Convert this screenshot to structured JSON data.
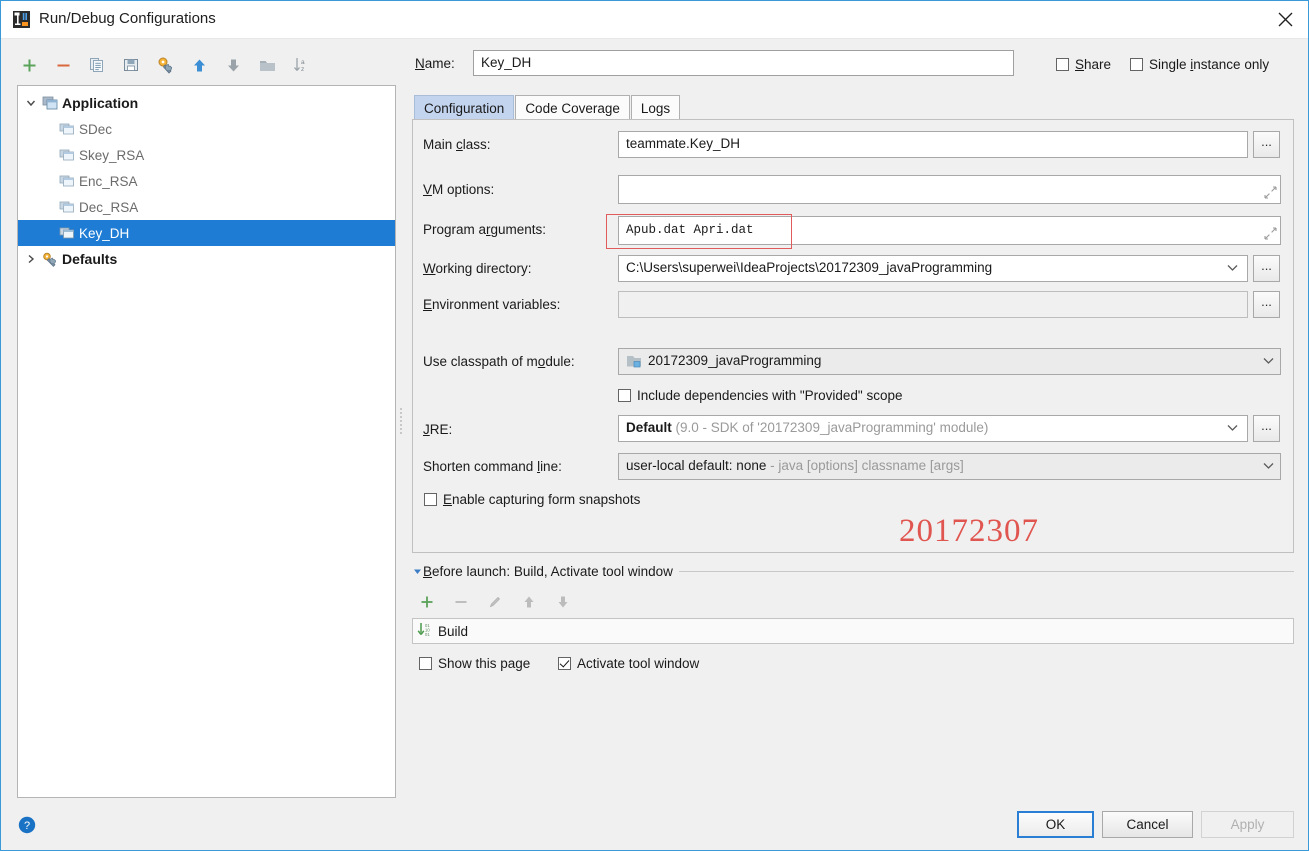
{
  "window": {
    "title": "Run/Debug Configurations",
    "app_icon": "intellij-idea-icon",
    "close_icon": "close-icon"
  },
  "toolbar": {
    "buttons": [
      {
        "name": "add-configuration-button",
        "icon": "plus-icon"
      },
      {
        "name": "remove-configuration-button",
        "icon": "minus-icon"
      },
      {
        "name": "copy-configuration-button",
        "icon": "copy-icon"
      },
      {
        "name": "save-configuration-button",
        "icon": "save-icon"
      },
      {
        "name": "edit-templates-button",
        "icon": "wrench-icon"
      },
      {
        "name": "move-up-button",
        "icon": "arrow-up-icon"
      },
      {
        "name": "move-down-button",
        "icon": "arrow-down-icon"
      },
      {
        "name": "move-into-folder-button",
        "icon": "folder-icon"
      },
      {
        "name": "sort-alphabetically-button",
        "icon": "sort-az-icon"
      }
    ]
  },
  "tree": {
    "items": [
      {
        "label": "Application",
        "icon": "application-icon",
        "bold": true,
        "twisty": "expanded",
        "indent": 0,
        "selected": false
      },
      {
        "label": "SDec",
        "icon": "run-config-icon",
        "bold": false,
        "twisty": "none",
        "indent": 1,
        "selected": false
      },
      {
        "label": "Skey_RSA",
        "icon": "run-config-icon",
        "bold": false,
        "twisty": "none",
        "indent": 1,
        "selected": false
      },
      {
        "label": "Enc_RSA",
        "icon": "run-config-icon",
        "bold": false,
        "twisty": "none",
        "indent": 1,
        "selected": false
      },
      {
        "label": "Dec_RSA",
        "icon": "run-config-icon",
        "bold": false,
        "twisty": "none",
        "indent": 1,
        "selected": false
      },
      {
        "label": "Key_DH",
        "icon": "run-config-icon",
        "bold": false,
        "twisty": "none",
        "indent": 1,
        "selected": true
      },
      {
        "label": "Defaults",
        "icon": "defaults-icon",
        "bold": true,
        "twisty": "collapsed",
        "indent": 0,
        "selected": false
      }
    ]
  },
  "name_row": {
    "label": "Name:",
    "value": "Key_DH",
    "share": {
      "label": "Share",
      "checked": false
    },
    "single_instance": {
      "label": "Single instance only",
      "checked": false
    }
  },
  "tabs": [
    {
      "label": "Configuration",
      "active": true
    },
    {
      "label": "Code Coverage",
      "active": false
    },
    {
      "label": "Logs",
      "active": false
    }
  ],
  "configuration": {
    "main_class": {
      "label": "Main class:",
      "value": "teammate.Key_DH",
      "browse": "..."
    },
    "vm_options": {
      "label": "VM options:",
      "value": "",
      "expand_icon": "expand-icon"
    },
    "program_arguments": {
      "label": "Program arguments:",
      "value": "Apub.dat Apri.dat",
      "expand_icon": "expand-icon",
      "highlight_color": "#e05b5b"
    },
    "working_directory": {
      "label": "Working directory:",
      "value": "C:\\Users\\superwei\\IdeaProjects\\20172309_javaProgramming",
      "browse": "..."
    },
    "environment_variables": {
      "label": "Environment variables:",
      "value": "",
      "browse": "..."
    },
    "use_classpath_of_module": {
      "label": "Use classpath of module:",
      "value": "20172309_javaProgramming",
      "icon": "module-icon"
    },
    "include_provided": {
      "label": "Include dependencies with \"Provided\" scope",
      "checked": false
    },
    "jre": {
      "label": "JRE:",
      "value": "Default",
      "hint": "(9.0 - SDK of '20172309_javaProgramming' module)",
      "browse": "..."
    },
    "shorten_command_line": {
      "label": "Shorten command line:",
      "value": "user-local default: none",
      "hint": "- java [options] classname [args]"
    },
    "enable_snapshots": {
      "label": "Enable capturing form snapshots",
      "checked": false
    },
    "watermark": "20172307"
  },
  "before_launch": {
    "title": "Before launch: Build, Activate tool window",
    "twisty": "expanded",
    "toolbar": [
      {
        "name": "add-task-button",
        "icon": "plus-icon"
      },
      {
        "name": "remove-task-button",
        "icon": "minus-icon"
      },
      {
        "name": "edit-task-button",
        "icon": "pencil-icon"
      },
      {
        "name": "move-task-up-button",
        "icon": "arrow-up-icon"
      },
      {
        "name": "move-task-down-button",
        "icon": "arrow-down-icon"
      }
    ],
    "items": [
      {
        "label": "Build",
        "icon": "build-icon"
      }
    ],
    "show_this_page": {
      "label": "Show this page",
      "checked": false
    },
    "activate_tool_window": {
      "label": "Activate tool window",
      "checked": true
    }
  },
  "footer": {
    "help_icon": "help-icon",
    "ok": "OK",
    "cancel": "Cancel",
    "apply": "Apply"
  }
}
